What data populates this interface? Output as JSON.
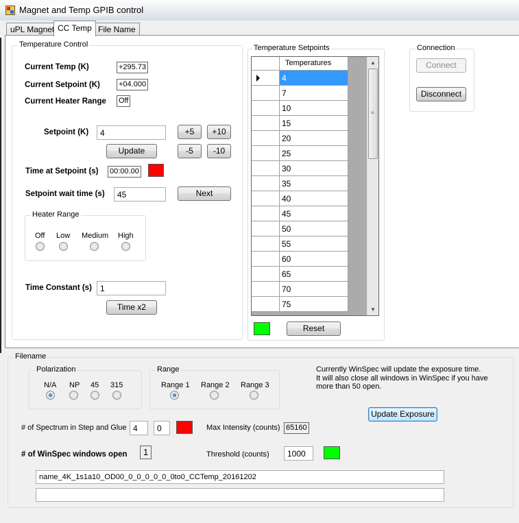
{
  "window": {
    "title": "Magnet and Temp GPIB control"
  },
  "tabs": [
    {
      "label": "uPL Magnet",
      "active": false
    },
    {
      "label": "CC Temp",
      "active": true
    },
    {
      "label": "File Name",
      "active": false
    }
  ],
  "temperature_control": {
    "group_label": "Temperature Control",
    "current_temp_label": "Current Temp (K)",
    "current_temp_value": "+295.73",
    "current_setpoint_label": "Current Setpoint (K)",
    "current_setpoint_value": "+04.000",
    "current_heater_range_label": "Current Heater Range",
    "current_heater_range_value": "Off",
    "setpoint_label": "Setpoint (K)",
    "setpoint_value": "4",
    "plus5_label": "+5",
    "plus10_label": "+10",
    "minus5_label": "-5",
    "minus10_label": "-10",
    "update_label": "Update",
    "time_at_setpoint_label": "Time at Setpoint (s)",
    "time_at_setpoint_value": "00:00.00",
    "time_at_setpoint_color": "#ff0000",
    "wait_time_label": "Setpoint wait time (s)",
    "wait_time_value": "45",
    "next_label": "Next",
    "heater_range": {
      "group_label": "Heater Range",
      "options": [
        "Off",
        "Low",
        "Medium",
        "High"
      ],
      "selected": null
    },
    "time_constant_label": "Time Constant (s)",
    "time_constant_value": "1",
    "time_x2_label": "Time x2"
  },
  "setpoints": {
    "group_label": "Temperature Setpoints",
    "column_header": "Temperatures",
    "rows": [
      "4",
      "7",
      "10",
      "15",
      "20",
      "25",
      "30",
      "35",
      "40",
      "45",
      "50",
      "55",
      "60",
      "65",
      "70",
      "75"
    ],
    "selected_index": 0,
    "status_color": "#00ff00",
    "reset_label": "Reset"
  },
  "connection": {
    "group_label": "Connection",
    "connect_label": "Connect",
    "disconnect_label": "Disconnect"
  },
  "filename": {
    "group_label": "Filename",
    "polarization": {
      "group_label": "Polarization",
      "options": [
        "N/A",
        "NP",
        "45",
        "315"
      ],
      "selected": "N/A"
    },
    "range": {
      "group_label": "Range",
      "options": [
        "Range 1",
        "Range 2",
        "Range 3"
      ],
      "selected": "Range 1"
    },
    "info_text_1": "Currently WinSpec will update the exposure time.",
    "info_text_2": "It will also close all windows in WinSpec if you have",
    "info_text_3": "more than 50 open.",
    "update_exposure_label": "Update Exposure",
    "spectrum_label": "# of Spectrum in Step and Glue",
    "spectrum_value_1": "4",
    "spectrum_value_2": "0",
    "spectrum_color": "#ff0000",
    "max_intensity_label": "Max Intensity (counts)",
    "max_intensity_value": "65160",
    "winspec_label": "# of WinSpec windows open",
    "winspec_value": "1",
    "threshold_label": "Threshold (counts)",
    "threshold_value": "1000",
    "threshold_color": "#00ff00",
    "filename_value": "name_4K_1s1a10_OD00_0_0_0_0_0_0to0_CCTemp_20161202",
    "filename_value_2": ""
  }
}
